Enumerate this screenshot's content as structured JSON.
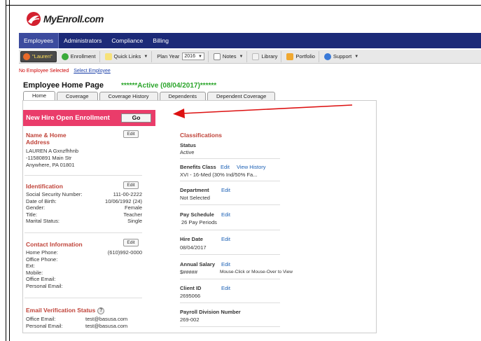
{
  "brand": {
    "logo_text": "MyEnroll.com"
  },
  "topnav": {
    "items": [
      "Employees",
      "Administrators",
      "Compliance",
      "Billing"
    ]
  },
  "toolbar": {
    "user_label": "\"Lauren\"",
    "enrollment": "Enrollment",
    "quick_links": "Quick Links",
    "plan_year_label": "Plan Year",
    "plan_year_value": "2016",
    "notes": "Notes",
    "library": "Library",
    "portfolio": "Portfolio",
    "support": "Support"
  },
  "subbar": {
    "no_employee": "No Employee Selected",
    "select_employee": "Select Employee"
  },
  "page": {
    "title": "Employee Home Page",
    "status": "******Active (08/04/2017)******"
  },
  "tabs": [
    "Home",
    "Coverage",
    "Coverage History",
    "Dependents",
    "Dependent Coverage"
  ],
  "nhoe": {
    "label": "New Hire Open Enrollment",
    "go": "Go"
  },
  "edit_label": "Edit",
  "name_address": {
    "title_line1": "Name & Home",
    "title_line2": "Address",
    "name": "LAUREN A Gxnzfhhnb",
    "street": "-11580891 Main Str",
    "city": "Anywhere, PA 01801"
  },
  "identification": {
    "title": "Identification",
    "rows": [
      {
        "label": "Social Security Number:",
        "value": "111-00-2222"
      },
      {
        "label": "Date of Birth:",
        "value": "10/06/1992 (24)"
      },
      {
        "label": "Gender:",
        "value": "Female"
      },
      {
        "label": "Title:",
        "value": "Teacher"
      },
      {
        "label": "Marital Status:",
        "value": "Single"
      }
    ]
  },
  "contact": {
    "title": "Contact Information",
    "rows": [
      {
        "label": "Home Phone:",
        "value": "(610)992-0000"
      },
      {
        "label": "Office Phone:",
        "value": ""
      },
      {
        "label": "Ext:",
        "value": ""
      },
      {
        "label": "Mobile:",
        "value": ""
      },
      {
        "label": "Office Email:",
        "value": ""
      },
      {
        "label": "Personal Email:",
        "value": ""
      }
    ]
  },
  "email_verification": {
    "title": "Email Verification Status",
    "help": "?",
    "rows": [
      {
        "label": "Office Email:",
        "value": "test@basusa.com"
      },
      {
        "label": "Personal Email:",
        "value": "test@basusa.com"
      }
    ]
  },
  "classifications": {
    "title": "Classifications",
    "status_label": "Status",
    "status_value": "Active",
    "benefits_class_label": "Benefits Class",
    "benefits_class_edit": "Edit",
    "benefits_class_history": "View History",
    "benefits_class_value": "XVI - 16-Med (30% Ind/50% Fa...",
    "department_label": "Department",
    "department_edit": "Edit",
    "department_value": "Not Selected",
    "pay_schedule_label": "Pay Schedule",
    "pay_schedule_edit": "Edit",
    "pay_schedule_value": "26 Pay Periods",
    "hire_date_label": "Hire Date",
    "hire_date_edit": "Edit",
    "hire_date_value": "08/04/2017",
    "annual_salary_label": "Annual Salary",
    "annual_salary_edit": "Edit",
    "annual_salary_value": "$#####",
    "annual_salary_note": "Mouse-Click or Mouse-Over to View",
    "client_id_label": "Client ID",
    "client_id_edit": "Edit",
    "client_id_value": "2695066",
    "payroll_label": "Payroll Division Number",
    "payroll_value": "269-002"
  },
  "colors": {
    "nav_bg": "#1c2a78",
    "nhoe_bg": "#ea3c6a",
    "section_title": "#c0443a",
    "status_green": "#2aa52a",
    "arrow_red": "#dd1111"
  }
}
